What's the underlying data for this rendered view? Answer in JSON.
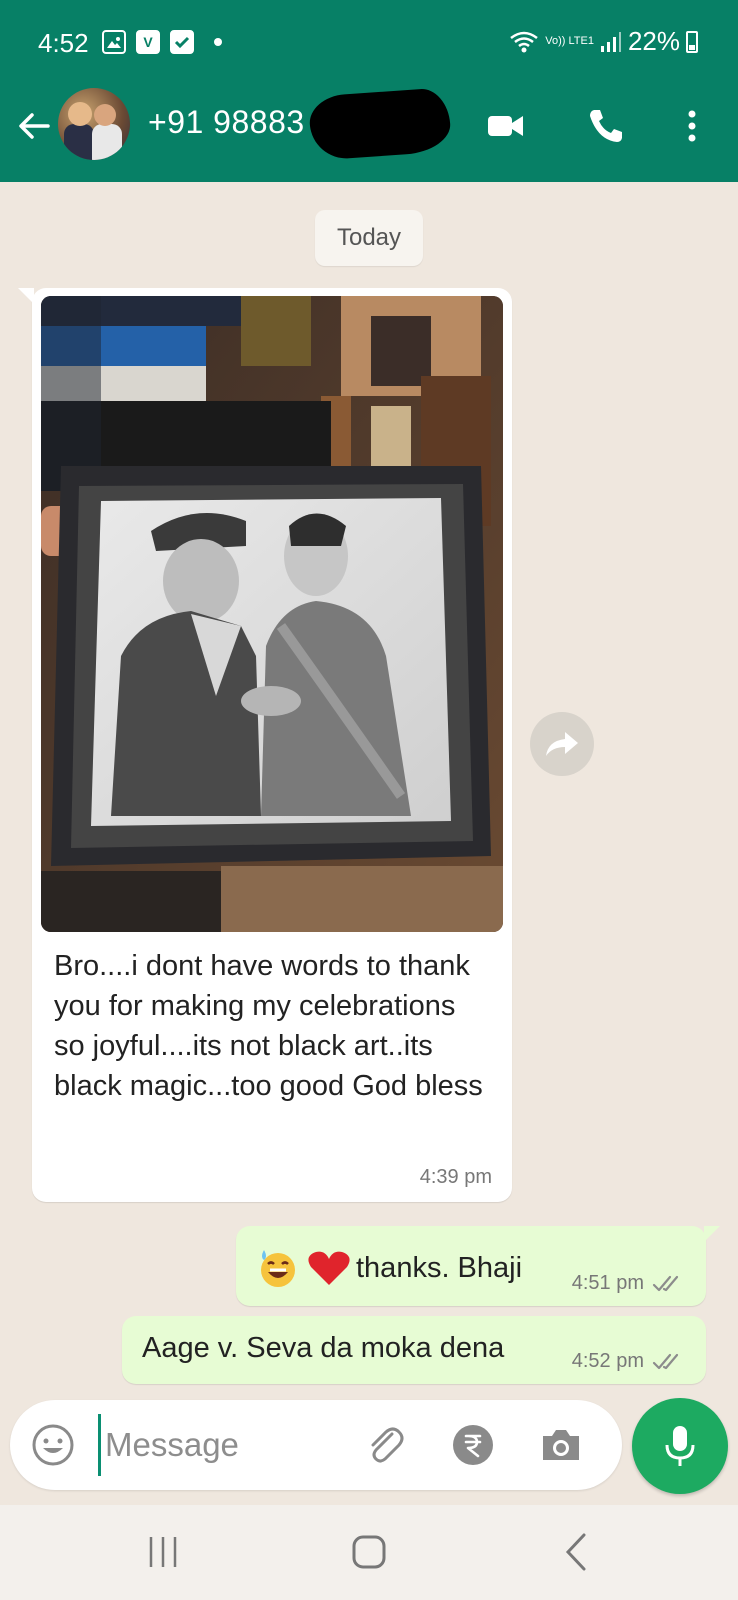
{
  "status_bar": {
    "time": "4:52",
    "network_label": "Vo)) LTE1",
    "battery": "22%"
  },
  "header": {
    "contact_name": "+91 98883",
    "icons": [
      "back-arrow-icon",
      "video-call-icon",
      "voice-call-icon",
      "more-options-icon"
    ]
  },
  "chat": {
    "date_chip": "Today",
    "incoming": {
      "caption": "Bro....i dont have words to thank you for making my celebrations so joyful....its not black art..its black magic...too good God bless",
      "time": "4:39 pm"
    },
    "outgoing": [
      {
        "text": "thanks. Bhaji",
        "time": "4:51 pm",
        "emojis": [
          "😅",
          "❤"
        ],
        "status": "delivered"
      },
      {
        "text": "Aage v. Seva da moka dena",
        "time": "4:52 pm",
        "status": "delivered"
      }
    ]
  },
  "composer": {
    "placeholder": "Message",
    "icons": [
      "emoji-icon",
      "attach-icon",
      "rupee-payment-icon",
      "camera-icon",
      "mic-icon"
    ]
  },
  "colors": {
    "header_bg": "#078066",
    "chat_bg": "#efe7de",
    "outgoing_bubble": "#e7fcd4",
    "mic_button": "#1daa61"
  }
}
